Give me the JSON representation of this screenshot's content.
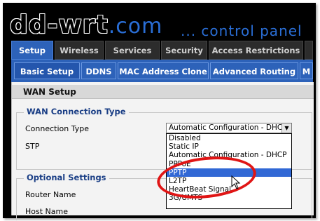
{
  "logo": {
    "dd": "dd",
    "wrt": "-wrt",
    "com": ".com"
  },
  "tagline": "... control panel",
  "main_tabs": [
    {
      "label": "Setup"
    },
    {
      "label": "Wireless"
    },
    {
      "label": "Services"
    },
    {
      "label": "Security"
    },
    {
      "label": "Access Restrictions"
    }
  ],
  "sub_tabs": [
    {
      "label": "Basic Setup"
    },
    {
      "label": "DDNS"
    },
    {
      "label": "MAC Address Clone"
    },
    {
      "label": "Advanced Routing"
    },
    {
      "label": "M"
    }
  ],
  "section_title": "WAN Setup",
  "wan_connection": {
    "legend": "WAN Connection Type",
    "connection_type_label": "Connection Type",
    "stp_label": "STP",
    "selected": "Automatic Configuration - DHCP",
    "options": [
      "Disabled",
      "Static IP",
      "Automatic Configuration - DHCP",
      "PPPoE",
      "PPTP",
      "L2TP",
      "HeartBeat Signal",
      "3G/UMTS"
    ],
    "highlighted_option": "PPTP"
  },
  "optional": {
    "legend": "Optional Settings",
    "router_name_label": "Router Name",
    "host_name_label": "Host Name"
  },
  "colors": {
    "accent": "#2d62b9",
    "logo_blue": "#2a6ed6",
    "highlight_ring": "#e01515",
    "selected_option": "#3168d5"
  }
}
